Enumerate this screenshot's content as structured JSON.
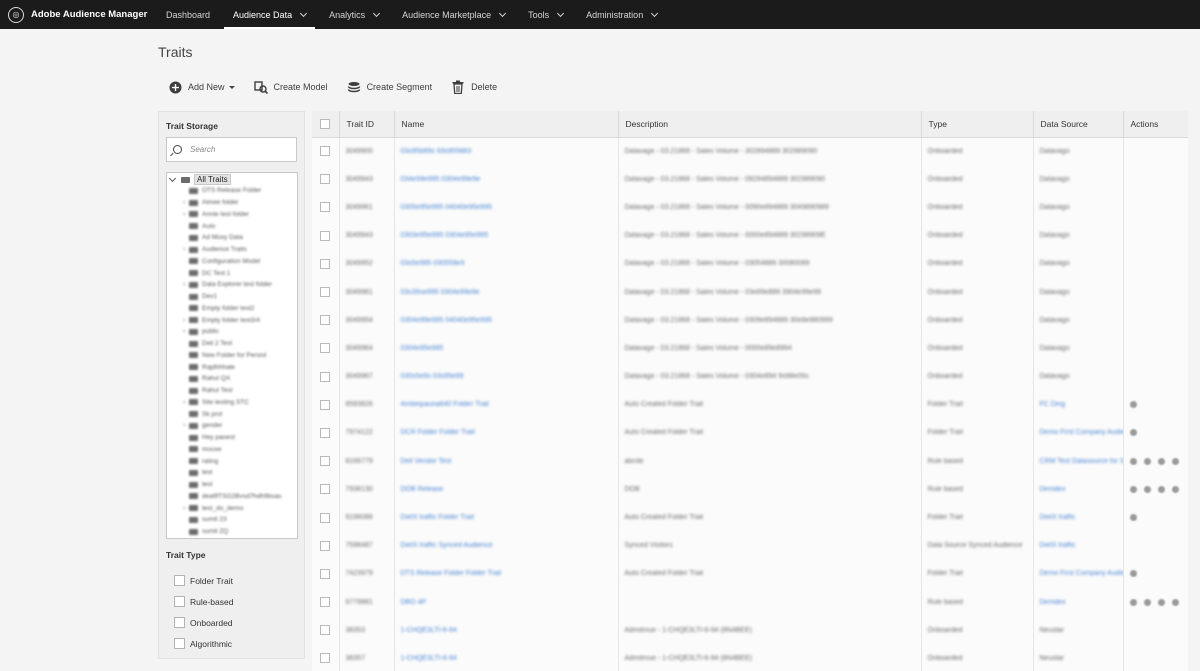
{
  "app": {
    "name": "Adobe Audience Manager"
  },
  "nav": {
    "items": [
      {
        "label": "Dashboard",
        "has_menu": false
      },
      {
        "label": "Audience Data",
        "has_menu": true,
        "active": true
      },
      {
        "label": "Analytics",
        "has_menu": true
      },
      {
        "label": "Audience Marketplace",
        "has_menu": true
      },
      {
        "label": "Tools",
        "has_menu": true
      },
      {
        "label": "Administration",
        "has_menu": true
      }
    ]
  },
  "page": {
    "title": "Traits"
  },
  "toolbar": {
    "add_new": "Add New",
    "create_model": "Create Model",
    "create_segment": "Create Segment",
    "delete": "Delete"
  },
  "storage": {
    "title": "Trait Storage",
    "search_placeholder": "Search",
    "root": "All Traits",
    "folders": [
      "OTS Release Folder",
      "Aimee folder",
      "Annie test folder",
      "Auto",
      "Ad Moxy Data",
      "Audience Traits",
      "Configuration Model",
      "DC Test 1",
      "Data Explorer test folder",
      "Dev1",
      "Empty folder test2",
      "Empty folder test3/4",
      "public",
      "Deli 2 Test",
      "New Folder for Persist",
      "Rajdhhhale",
      "Rahul QA",
      "Rahul Test",
      "Site testing STC",
      "Sk prol",
      "gender",
      "Hey paoest",
      "mouse",
      "rating",
      "test",
      "test",
      "dea9fTSG2Bvsd7hdh9bsas",
      "test_do_demo",
      "sumit 23",
      "sumit ZQ"
    ]
  },
  "trait_type": {
    "title": "Trait Type",
    "options": [
      "Folder Trait",
      "Rule-based",
      "Onboarded",
      "Algorithmic"
    ]
  },
  "table": {
    "columns": [
      "Trait ID",
      "Name",
      "Description",
      "Type",
      "Data Source",
      "Actions"
    ],
    "rows": [
      {
        "id": "3049900",
        "name": "03s95b89s 93s955883",
        "desc": "Datavage - 03.21868 - Sales Volume - 302894889 302989090",
        "type": "Onboarded",
        "source": "Datavago",
        "source_link": false,
        "actions": 0
      },
      {
        "id": "3049943",
        "name": "034e59e995 0304e99e9e",
        "desc": "Datavage - 03.21868 - Sales Volume - 09294894889 302989090",
        "type": "Onboarded",
        "source": "Datavago",
        "source_link": false,
        "actions": 0
      },
      {
        "id": "3049961",
        "name": "0305e95e995 04040e95e995",
        "desc": "Datavage - 03.21868 - Sales Volume - 0090e894889 3049890989",
        "type": "Onboarded",
        "source": "Datavago",
        "source_link": false,
        "actions": 0
      },
      {
        "id": "3049943",
        "name": "0303e95e995 0304e95e995",
        "desc": "Datavage - 03.21868 - Sales Volume - 0000e894889 30298909E",
        "type": "Onboarded",
        "source": "Datavago",
        "source_link": false,
        "actions": 0
      },
      {
        "id": "3049952",
        "name": "03s5e995 030559e9",
        "desc": "Datavage - 03.21868 - Sales Volume - 03054889 30080089",
        "type": "Onboarded",
        "source": "Datavago",
        "source_link": false,
        "actions": 0
      },
      {
        "id": "3049961",
        "name": "03s39se995 0304e99e9e",
        "desc": "Datavage - 03.21868 - Sales Volume - 03e89e889 3904e99e99",
        "type": "Onboarded",
        "source": "Datavago",
        "source_link": false,
        "actions": 0
      },
      {
        "id": "3049954",
        "name": "0304e99e995 04040e95e995",
        "desc": "Datavage - 03.21868 - Sales Volume - 0309e894889 30e8e980999",
        "type": "Onboarded",
        "source": "Datavago",
        "source_link": false,
        "actions": 0
      },
      {
        "id": "3049964",
        "name": "0304e95e995",
        "desc": "Datavage - 03.21868 - Sales Volume - 0000e89e8994",
        "type": "Onboarded",
        "source": "Datavago",
        "source_link": false,
        "actions": 0
      },
      {
        "id": "3049967",
        "name": "030s5e9s 03s95e99",
        "desc": "Datavage - 03.21868 - Sales Volume - 0304e894 9s98e09s",
        "type": "Onboarded",
        "source": "Datavago",
        "source_link": false,
        "actions": 0
      },
      {
        "id": "8593826",
        "name": "Ambeipauna640 Folder Trait",
        "desc": "Auto Created Folder Trait",
        "type": "Folder Trait",
        "source": "FC Ding",
        "source_link": true,
        "actions": 1
      },
      {
        "id": "7974122",
        "name": "DCR Folder Folder Trait",
        "desc": "Auto Created Folder Trait",
        "type": "Folder Trait",
        "source": "Demo First Company Audience",
        "source_link": true,
        "actions": 1
      },
      {
        "id": "8166779",
        "name": "Dell Vendor Test",
        "desc": "abcde",
        "type": "Rule based",
        "source": "CRM Test Datasource for Superfile Release",
        "source_link": true,
        "actions": 4
      },
      {
        "id": "7938130",
        "name": "DOB Release",
        "desc": "DOB",
        "type": "Rule based",
        "source": "Demdex",
        "source_link": true,
        "actions": 4
      },
      {
        "id": "9196086",
        "name": "DietX traffic Folder Trait",
        "desc": "Auto Created Folder Trait",
        "type": "Folder Trait",
        "source": "DietX traffic",
        "source_link": true,
        "actions": 1
      },
      {
        "id": "7598487",
        "name": "DietX traffic Synced Audience",
        "desc": "Synced Visitors",
        "type": "Data Source Synced Audience",
        "source": "DietX traffic",
        "source_link": true,
        "actions": 0
      },
      {
        "id": "7423979",
        "name": "DTS Release Folder Folder Trait",
        "desc": "Auto Created Folder Trait",
        "type": "Folder Trait",
        "source": "Demo First Company Audience",
        "source_link": true,
        "actions": 1
      },
      {
        "id": "6779881",
        "name": "DBO 4P",
        "desc": "",
        "type": "Rule based",
        "source": "Demdex",
        "source_link": true,
        "actions": 4
      },
      {
        "id": "38353",
        "name": "1-CHQE3LTI-6-94",
        "desc": "Admitmue - 1-CHQE3LTI-6-94 (8N4BEE)",
        "type": "Onboarded",
        "source": "Neustar",
        "source_link": false,
        "actions": 0
      },
      {
        "id": "38357",
        "name": "1-CHQE3LTI-6-94",
        "desc": "Admitmue - 1-CHQE3LTI-6-94 (8N4BEE)",
        "type": "Onboarded",
        "source": "Neustar",
        "source_link": false,
        "actions": 0
      }
    ]
  }
}
